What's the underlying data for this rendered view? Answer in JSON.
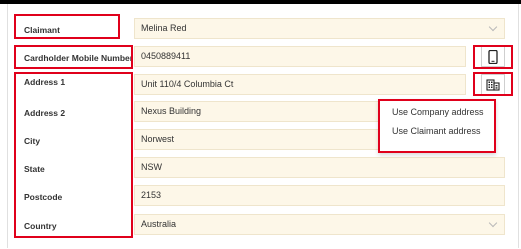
{
  "form": {
    "claimant": {
      "label": "Claimant",
      "value": "Melina Red"
    },
    "cardholder_mobile": {
      "label": "Cardholder Mobile Number",
      "value": "0450889411"
    },
    "address1": {
      "label": "Address 1",
      "value": "Unit 110/4 Columbia Ct"
    },
    "address2": {
      "label": "Address 2",
      "value": "Nexus Building"
    },
    "city": {
      "label": "City",
      "value": "Norwest"
    },
    "state": {
      "label": "State",
      "value": "NSW"
    },
    "postcode": {
      "label": "Postcode",
      "value": "2153"
    },
    "country": {
      "label": "Country",
      "value": "Australia"
    }
  },
  "address_menu": {
    "items": [
      "Use Company address",
      "Use Claimant address"
    ]
  },
  "icons": {
    "mobile": "mobile-phone-icon",
    "address": "building-icon"
  },
  "colors": {
    "highlight": "#e0001b",
    "field_bg": "#fdf7e8"
  }
}
